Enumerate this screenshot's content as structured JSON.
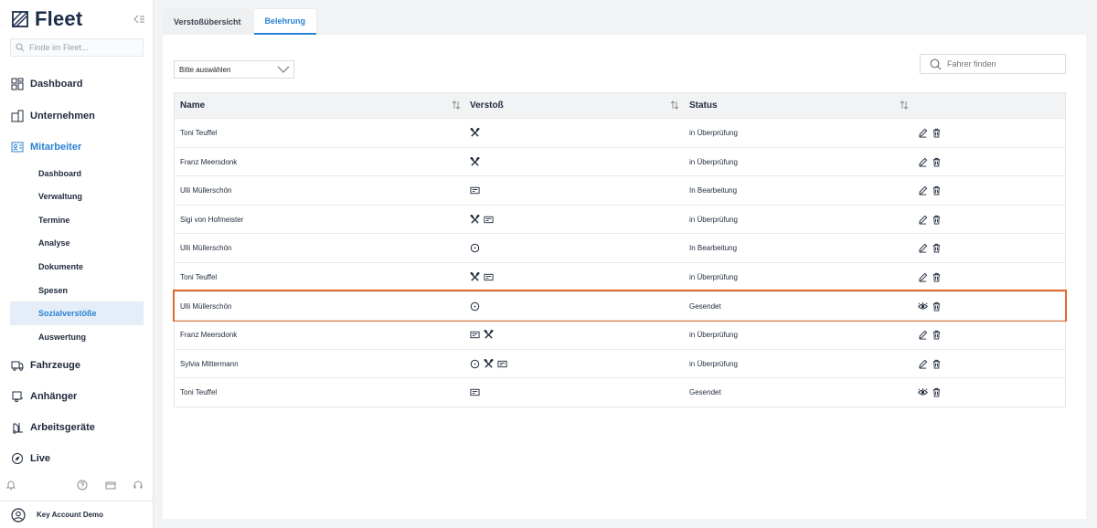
{
  "app": {
    "name": "Fleet"
  },
  "sidebar": {
    "search_placeholder": "Finde im Fleet...",
    "nav": [
      {
        "label": "Dashboard"
      },
      {
        "label": "Unternehmen"
      },
      {
        "label": "Mitarbeiter"
      },
      {
        "label": "Fahrzeuge"
      },
      {
        "label": "Anhänger"
      },
      {
        "label": "Arbeitsgeräte"
      },
      {
        "label": "Live"
      }
    ],
    "sub": [
      "Dashboard",
      "Verwaltung",
      "Termine",
      "Analyse",
      "Dokumente",
      "Spesen",
      "Sozialverstöße",
      "Auswertung"
    ],
    "user": "Key Account Demo"
  },
  "tabs": [
    "Verstoßübersicht",
    "Belehrung"
  ],
  "filter": {
    "select_value": "Bitte auswählen",
    "search_placeholder": "Fahrer finden"
  },
  "table": {
    "columns": [
      "Name",
      "Verstoß",
      "Status"
    ],
    "rows": [
      {
        "name": "Toni Teuffel",
        "violations": [
          "hammer-icon"
        ],
        "status": "in Überprüfung",
        "actions": [
          "edit-icon",
          "trash-icon"
        ]
      },
      {
        "name": "Franz Meersdonk",
        "violations": [
          "hammer-icon"
        ],
        "status": "in Überprüfung",
        "actions": [
          "edit-icon",
          "trash-icon"
        ]
      },
      {
        "name": "Ulli Müllerschön",
        "violations": [
          "card-icon"
        ],
        "status": "In Bearbeitung",
        "actions": [
          "edit-icon",
          "trash-icon"
        ]
      },
      {
        "name": "Sigi von Hofmeister",
        "violations": [
          "hammer-icon",
          "card-icon"
        ],
        "status": "in Überprüfung",
        "actions": [
          "edit-icon",
          "trash-icon"
        ]
      },
      {
        "name": "Ulli Müllerschön",
        "violations": [
          "clock-icon"
        ],
        "status": "In Bearbeitung",
        "actions": [
          "edit-icon",
          "trash-icon"
        ]
      },
      {
        "name": "Toni Teuffel",
        "violations": [
          "hammer-icon",
          "card-icon"
        ],
        "status": "in Überprüfung",
        "actions": [
          "edit-icon",
          "trash-icon"
        ]
      },
      {
        "name": "Ulli Müllerschön",
        "violations": [
          "clock-icon"
        ],
        "status": "Gesendet",
        "actions": [
          "eye-icon",
          "trash-icon"
        ]
      },
      {
        "name": "Franz Meersdonk",
        "violations": [
          "card-icon",
          "hammer-icon"
        ],
        "status": "in Überprüfung",
        "actions": [
          "edit-icon",
          "trash-icon"
        ]
      },
      {
        "name": "Sylvia Mittermann",
        "violations": [
          "clock-icon",
          "hammer-icon",
          "card-icon"
        ],
        "status": "in Überprüfung",
        "actions": [
          "edit-icon",
          "trash-icon"
        ]
      },
      {
        "name": "Toni Teuffel",
        "violations": [
          "card-icon"
        ],
        "status": "Gesendet",
        "actions": [
          "eye-icon",
          "trash-icon"
        ]
      }
    ]
  },
  "colors": {
    "accent": "#2a82d2",
    "highlight": "#e06a2a"
  }
}
